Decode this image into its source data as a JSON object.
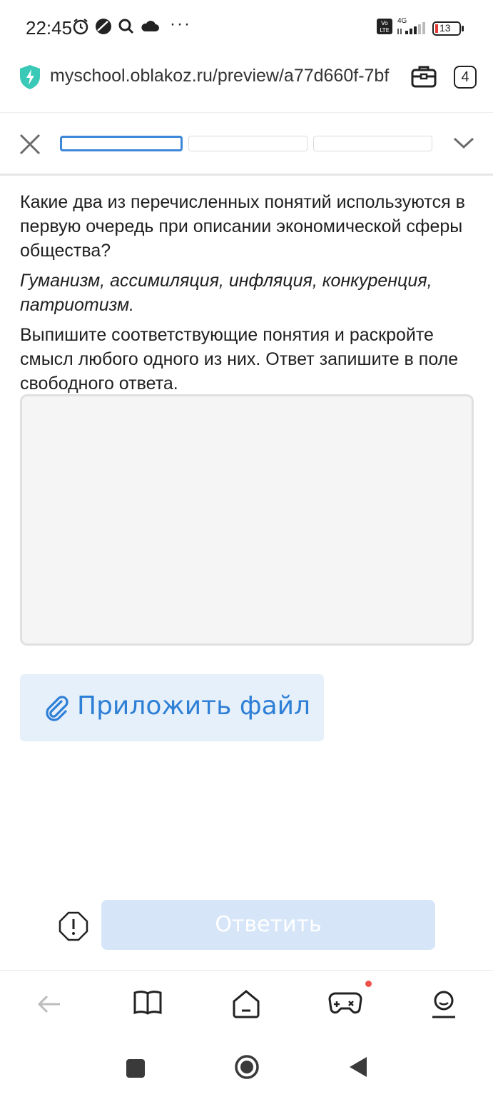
{
  "status_bar": {
    "time": "22:45",
    "battery": "13",
    "network": "4G",
    "volte": "Vo LTE",
    "more": "···"
  },
  "browser": {
    "url": "myschool.oblakoz.ru/preview/a77d660f-7bf",
    "tabs_count": "4"
  },
  "progress": {
    "segments": 3,
    "active_segment": 0
  },
  "question": {
    "text": "Какие два из перечисленных понятий используются в первую очередь при описании экономической сферы общества?",
    "terms": "Гуманизм, ассимиляция, инфляция, конкуренция, патриотизм.",
    "instructions": "Выпишите соответствующие понятия и раскройте смысл любого одного из них. Ответ запишите в поле свободного ответа."
  },
  "answer": {
    "value": ""
  },
  "attach": {
    "label": "Приложить файл"
  },
  "submit": {
    "label": "Ответить"
  },
  "colors": {
    "accent": "#2e7fd6",
    "attach_bg": "#e6f0fa",
    "submit_bg": "#d6e6f8",
    "notification_dot": "#f0504a"
  },
  "icons": {
    "bottom_nav": [
      "back-arrow-icon",
      "book-icon",
      "home-icon",
      "gamepad-icon",
      "profile-icon"
    ],
    "system_nav": [
      "recents-square-icon",
      "home-circle-icon",
      "back-triangle-icon"
    ]
  }
}
